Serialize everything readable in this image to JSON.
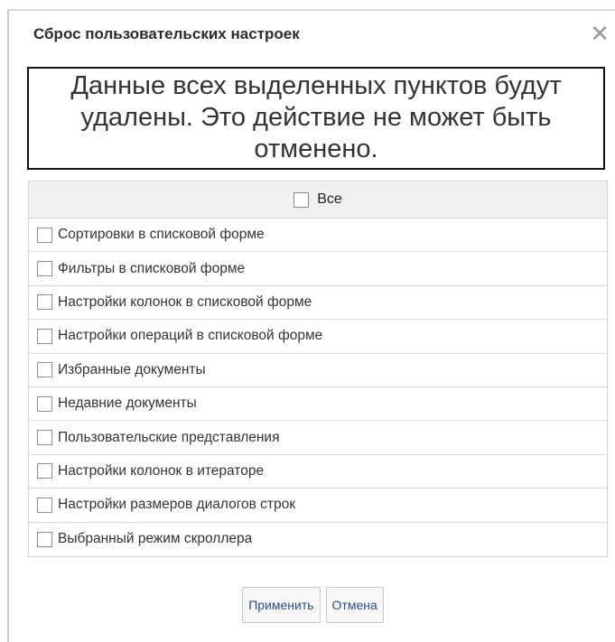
{
  "dialog": {
    "title": "Сброс пользовательских настроек",
    "close_icon": "close-icon",
    "warning": "Данные всех выделенных пунктов будут удалены. Это действие не может быть отменено."
  },
  "table": {
    "header_label": "Все",
    "items": [
      {
        "label": "Сортировки в списковой форме",
        "checked": false
      },
      {
        "label": "Фильтры в списковой форме",
        "checked": false
      },
      {
        "label": "Настройки колонок в списковой форме",
        "checked": false
      },
      {
        "label": "Настройки операций в списковой форме",
        "checked": false
      },
      {
        "label": "Избранные документы",
        "checked": false
      },
      {
        "label": "Недавние документы",
        "checked": false
      },
      {
        "label": "Пользовательские представления",
        "checked": false
      },
      {
        "label": "Настройки колонок в итераторе",
        "checked": false
      },
      {
        "label": "Настройки размеров диалогов строк",
        "checked": false
      },
      {
        "label": "Выбранный режим скроллера",
        "checked": false
      }
    ]
  },
  "buttons": {
    "apply_label": "Применить",
    "cancel_label": "Отмена"
  },
  "colors": {
    "border": "#d2d2d2",
    "header_bg": "#f0f0f0",
    "button_text": "#2f4d7c"
  }
}
